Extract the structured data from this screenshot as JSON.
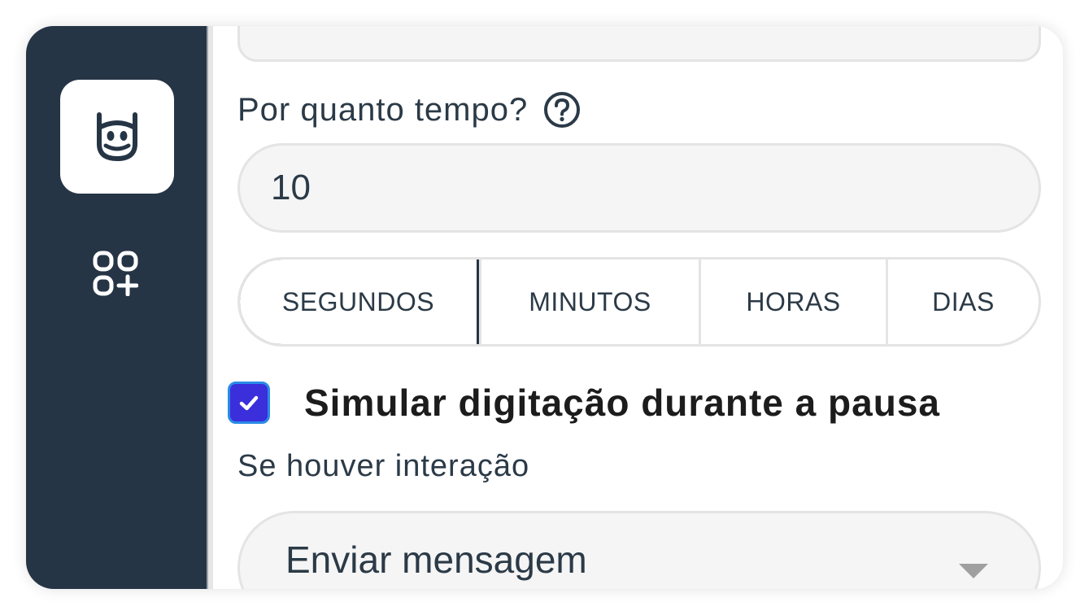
{
  "form": {
    "duration_label": "Por quanto tempo?",
    "duration_value": "10",
    "units": [
      "SEGUNDOS",
      "MINUTOS",
      "HORAS",
      "DIAS"
    ],
    "selected_unit": "SEGUNDOS",
    "simulate_typing_label": "Simular digitação durante a pausa",
    "simulate_typing_checked": true,
    "interaction_label": "Se houver interação",
    "interaction_action": "Enviar mensagem"
  },
  "sidebar": {
    "logo_icon": "bot-face-icon",
    "apps_icon": "add-apps-icon"
  },
  "colors": {
    "sidebar_bg": "#263545",
    "checkbox_fill": "#3a2fdb",
    "checkbox_border": "#2a8be8",
    "field_bg": "#f5f5f5"
  }
}
